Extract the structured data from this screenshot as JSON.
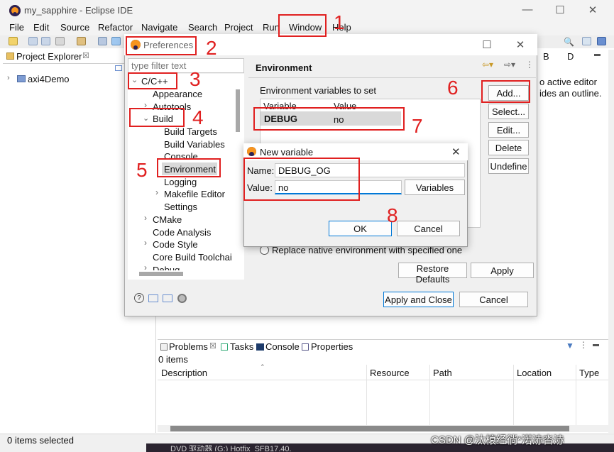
{
  "app": {
    "title": "my_sapphire - Eclipse IDE",
    "menu": [
      "File",
      "Edit",
      "Source",
      "Refactor",
      "Navigate",
      "Search",
      "Project",
      "Run",
      "Window",
      "Help"
    ]
  },
  "project_explorer": {
    "tab_label": "Project Explorer",
    "tab_suffix": "☒",
    "items": [
      "axi4Demo"
    ]
  },
  "outline": {
    "tab1": "B",
    "tab2": "D",
    "message_line1": "o active editor",
    "message_line2": "ides an outline."
  },
  "preferences": {
    "title": "Preferences",
    "filter_placeholder": "type filter text",
    "tree": {
      "cpp": "C/C++",
      "appearance": "Appearance",
      "autotools": "Autotools",
      "build": "Build",
      "build_targets": "Build Targets",
      "build_variables": "Build Variables",
      "console": "Console",
      "environment": "Environment",
      "logging": "Logging",
      "makefile_editor": "Makefile Editor",
      "settings": "Settings",
      "cmake": "CMake",
      "code_analysis": "Code Analysis",
      "code_style": "Code Style",
      "core_build": "Core Build Toolchair",
      "debug": "Debug"
    },
    "page_title": "Environment",
    "env_label": "Environment variables to set",
    "table": {
      "col_variable": "Variable",
      "col_value": "Value",
      "rows": [
        {
          "variable": "DEBUG",
          "value": "no"
        }
      ]
    },
    "buttons": {
      "add": "Add...",
      "select": "Select...",
      "edit": "Edit...",
      "delete": "Delete",
      "undefine": "Undefine",
      "restore_defaults": "Restore Defaults",
      "apply": "Apply",
      "apply_close": "Apply and Close",
      "cancel": "Cancel"
    },
    "replace_native_label": "Replace native environment with specified one"
  },
  "new_variable": {
    "title": "New variable",
    "name_label": "Name:",
    "name_value": "DEBUG_OG",
    "value_label": "Value:",
    "value_value": "no",
    "variables_button": "Variables",
    "ok": "OK",
    "cancel": "Cancel"
  },
  "bottom_panel": {
    "tabs": [
      "Problems",
      "Tasks",
      "Console",
      "Properties"
    ],
    "problems_tab_suffix": "☒",
    "items_count": "0 items",
    "columns": [
      "Description",
      "Resource",
      "Path",
      "Location",
      "Type"
    ]
  },
  "status": {
    "left": "0 items selected",
    "taskbar_text": "DVD 驱动器 (G:) Hotfix_SFB17.40."
  },
  "watermark": "CSDN @汰榱经徜*渃浾沓浾",
  "annotations": [
    "1",
    "2",
    "3",
    "4",
    "5",
    "6",
    "7",
    "8"
  ],
  "colors": {
    "annotation_red": "#e02020",
    "selection": "#d9d9d9",
    "focus_blue": "#0078d7"
  }
}
